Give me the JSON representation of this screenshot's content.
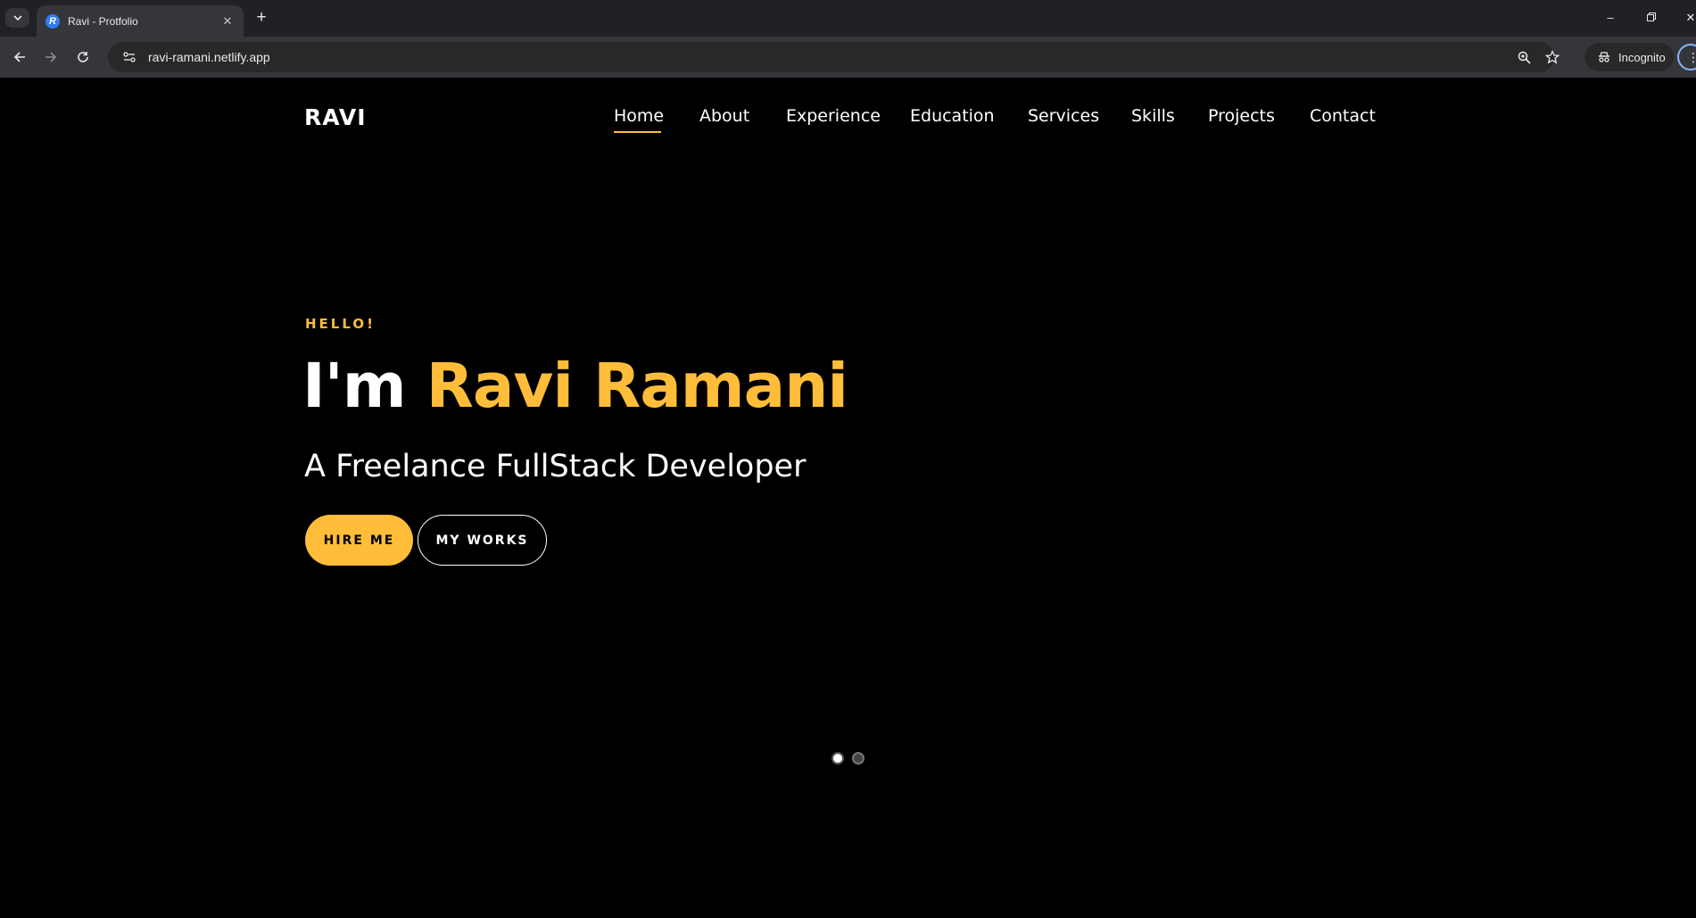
{
  "browser": {
    "tab": {
      "title": "Ravi - Protfolio",
      "favicon_letter": "R"
    },
    "url": "ravi-ramani.netlify.app",
    "incognito_label": "Incognito",
    "accent": "#8ab4f8"
  },
  "site": {
    "logo": "RAVI",
    "nav": [
      {
        "label": "Home",
        "active": true
      },
      {
        "label": "About",
        "active": false
      },
      {
        "label": "Experience",
        "active": false
      },
      {
        "label": "Education",
        "active": false
      },
      {
        "label": "Services",
        "active": false
      },
      {
        "label": "Skills",
        "active": false
      },
      {
        "label": "Projects",
        "active": false
      },
      {
        "label": "Contact",
        "active": false
      }
    ],
    "hero": {
      "greeting": "HELLO!",
      "headline_prefix": "I'm ",
      "headline_name": "Ravi Ramani",
      "subtitle": "A Freelance FullStack Developer",
      "primary_button": "HIRE ME",
      "secondary_button": "MY WORKS"
    },
    "slider": {
      "slide_count": 2,
      "active_index": 0
    },
    "colors": {
      "accent": "#ffbd39",
      "background": "#000000",
      "text": "#ffffff"
    }
  }
}
